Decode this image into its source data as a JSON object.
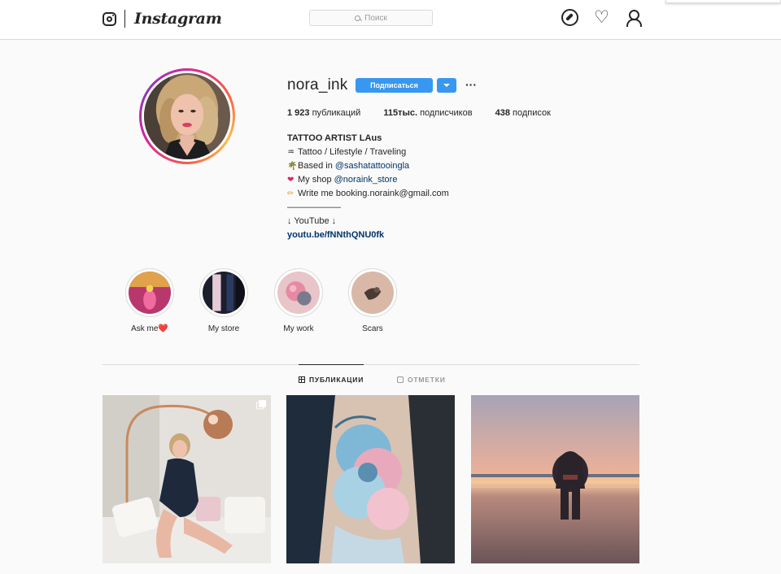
{
  "header": {
    "wordmark": "Instagram",
    "search_placeholder": "Поиск",
    "icons": [
      "camera-icon",
      "compass-icon",
      "heart-icon",
      "user-icon"
    ]
  },
  "profile": {
    "username": "nora_ink",
    "follow_label": "Подписаться",
    "more_label": "···",
    "stats": {
      "posts_count": "1 923",
      "posts_label": "публикаций",
      "followers_count": "115тыс.",
      "followers_label": "подписчиков",
      "following_count": "438",
      "following_label": "подписок"
    },
    "bio": {
      "full_name": "TATTOO ARTIST LAus",
      "line1": "Tattoo / Lifestyle / Traveling",
      "line2_prefix": "Based in ",
      "line2_mention": "@sashatattooingla",
      "line3_prefix": "My shop ",
      "line3_mention": "@noraink_store",
      "line4": "Write me booking.noraink@gmail.com",
      "separator": "——————",
      "line5": "↓ YouTube ↓",
      "link": "youtu.be/fNNthQNU0fk"
    }
  },
  "highlights": [
    {
      "label": "Ask me❤️"
    },
    {
      "label": "My store"
    },
    {
      "label": "My work"
    },
    {
      "label": "Scars"
    }
  ],
  "tabs": {
    "posts": "ПУБЛИКАЦИИ",
    "tagged": "ОТМЕТКИ"
  },
  "colors": {
    "accent": "#3897f0",
    "link": "#003569",
    "border": "#dbdbdb",
    "background": "#fafafa"
  }
}
